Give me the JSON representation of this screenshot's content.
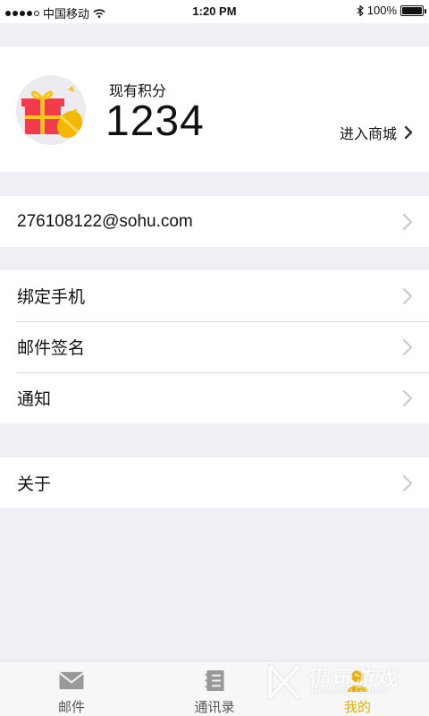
{
  "status_bar": {
    "carrier": "中国移动",
    "time": "1:20 PM",
    "battery_text": "100%",
    "battery_level": 1.0
  },
  "points": {
    "label": "现有积分",
    "value": "1234",
    "mall_link": "进入商城"
  },
  "account": {
    "email": "276108122@sohu.com"
  },
  "settings": {
    "items": [
      {
        "label": "绑定手机"
      },
      {
        "label": "邮件签名"
      },
      {
        "label": "通知"
      }
    ]
  },
  "about": {
    "label": "关于"
  },
  "tab_bar": {
    "tabs": [
      {
        "label": "邮件",
        "icon": "mail-icon"
      },
      {
        "label": "通讯录",
        "icon": "contacts-icon"
      },
      {
        "label": "我的",
        "icon": "profile-icon",
        "active": true
      }
    ]
  },
  "watermark": {
    "title": "仍玩游戏",
    "subtitle": "Rengwan Games"
  },
  "colors": {
    "accent": "#e7b100",
    "background": "#efeff4"
  }
}
